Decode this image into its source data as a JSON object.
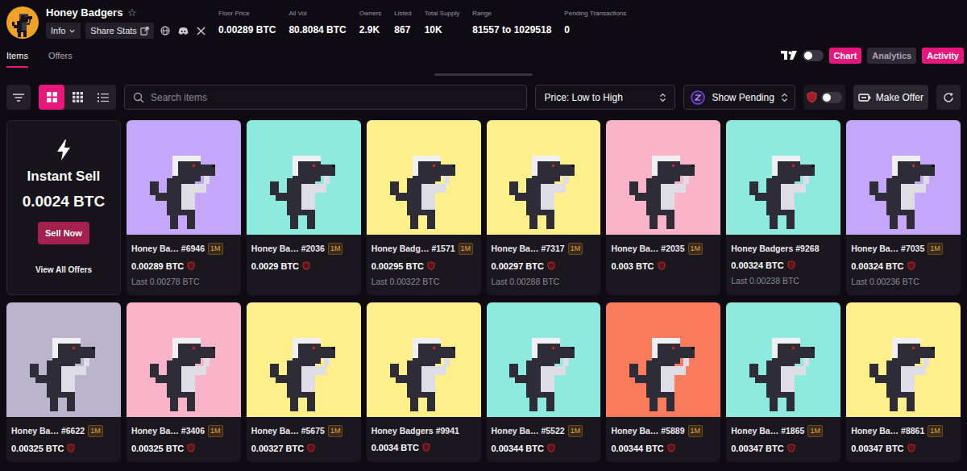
{
  "collection": {
    "name": "Honey Badgers",
    "star": "☆",
    "info": "Info",
    "share": "Share Stats"
  },
  "stats": [
    {
      "label": "Floor Price",
      "value": "0.00289 BTC"
    },
    {
      "label": "All Vol",
      "value": "80.8084 BTC"
    },
    {
      "label": "Owners",
      "value": "2.9K"
    },
    {
      "label": "Listed",
      "value": "867"
    },
    {
      "label": "Total Supply",
      "value": "10K"
    },
    {
      "label": "Range",
      "value": "81557 to 1029518"
    },
    {
      "label": "Pending Transactions",
      "value": "0"
    }
  ],
  "tabs": [
    {
      "label": "Items",
      "selected": true
    },
    {
      "label": "Offers",
      "selected": false
    }
  ],
  "chart_toggle": {
    "on": false
  },
  "views": [
    {
      "label": "Chart",
      "selected": true
    },
    {
      "label": "Analytics",
      "selected": false
    },
    {
      "label": "Activity",
      "selected": true
    }
  ],
  "layouts": [
    {
      "kind": "large-grid",
      "selected": true
    },
    {
      "kind": "small-grid",
      "selected": false
    },
    {
      "kind": "list",
      "selected": false
    }
  ],
  "search": {
    "placeholder": "Search items"
  },
  "sort": {
    "value": "Price: Low to High"
  },
  "pending": {
    "label": "Show Pending"
  },
  "protect_toggle": {
    "on": false
  },
  "make_offer": "Make Offer",
  "instant_sell": {
    "title": "Instant Sell",
    "price": "0.0024 BTC",
    "button": "Sell Now",
    "link": "View All Offers"
  },
  "items": [
    {
      "name": "Honey Ba…",
      "number": "#6946",
      "badge": "1M",
      "price": "0.00289 BTC",
      "last": "Last 0.00278 BTC",
      "color": "#c4a6fb"
    },
    {
      "name": "Honey Ba…",
      "number": "#2036",
      "badge": "1M",
      "price": "0.0029 BTC",
      "color": "#8ee9df"
    },
    {
      "name": "Honey Badg…",
      "number": "#1571",
      "badge": "1M",
      "price": "0.00295 BTC",
      "last": "Last 0.00322 BTC",
      "color": "#fdf08a"
    },
    {
      "name": "Honey Ba…",
      "number": "#7317",
      "badge": "1M",
      "price": "0.00297 BTC",
      "last": "Last 0.00288 BTC",
      "color": "#fdf08a"
    },
    {
      "name": "Honey Ba…",
      "number": "#2035",
      "badge": "1M",
      "price": "0.003 BTC",
      "color": "#f9b4c9"
    },
    {
      "name": "Honey Badgers",
      "number": "#9268",
      "badge": "",
      "price": "0.00324 BTC",
      "last": "Last 0.00238 BTC",
      "color": "#8ee9df"
    },
    {
      "name": "Honey Ba…",
      "number": "#7035",
      "badge": "1M",
      "price": "0.00324 BTC",
      "last": "Last 0.00236 BTC",
      "color": "#c4a6fb"
    },
    {
      "name": "Honey Ba…",
      "number": "#6622",
      "badge": "1M",
      "price": "0.00325 BTC",
      "color": "#bab4cc"
    },
    {
      "name": "Honey Ba…",
      "number": "#3406",
      "badge": "1M",
      "price": "0.00325 BTC",
      "color": "#f9b4c9"
    },
    {
      "name": "Honey Ba…",
      "number": "#5675",
      "badge": "1M",
      "price": "0.00327 BTC",
      "color": "#fdf08a"
    },
    {
      "name": "Honey Badgers",
      "number": "#9941",
      "badge": "",
      "price": "0.0034 BTC",
      "color": "#fdf08a"
    },
    {
      "name": "Honey Ba…",
      "number": "#5522",
      "badge": "1M",
      "price": "0.00344 BTC",
      "color": "#8ee9df"
    },
    {
      "name": "Honey Ba…",
      "number": "#5889",
      "badge": "1M",
      "price": "0.00344 BTC",
      "color": "#fa7c5c"
    },
    {
      "name": "Honey Ba…",
      "number": "#1865",
      "badge": "1M",
      "price": "0.00347 BTC",
      "color": "#8ee9df"
    },
    {
      "name": "Honey Ba…",
      "number": "#8861",
      "badge": "1M",
      "price": "0.00347 BTC",
      "color": "#fdf08a"
    }
  ]
}
